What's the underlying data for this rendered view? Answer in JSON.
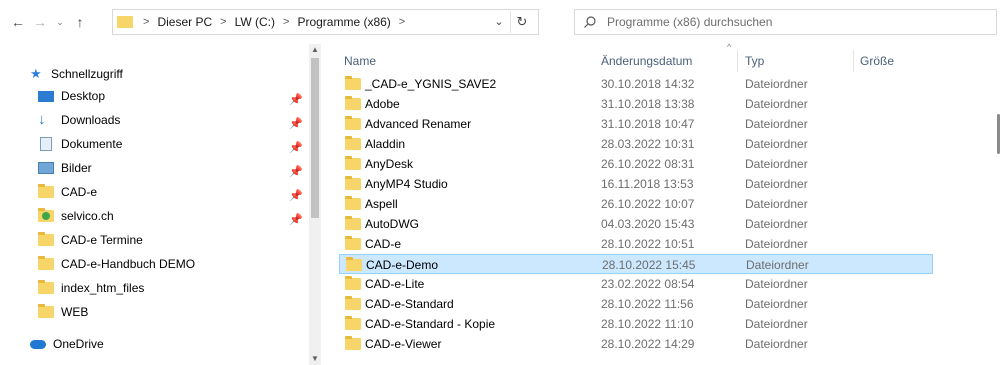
{
  "address": {
    "crumbs": [
      "Dieser PC",
      "LW (C:)",
      "Programme (x86)"
    ],
    "separator": ">"
  },
  "search": {
    "placeholder": "Programme (x86) durchsuchen"
  },
  "nav": {
    "quick_access": "Schnellzugriff",
    "items": [
      {
        "label": "Desktop",
        "icon": "desktop-icon",
        "pinned": true
      },
      {
        "label": "Downloads",
        "icon": "download-icon",
        "pinned": true
      },
      {
        "label": "Dokumente",
        "icon": "documents-icon",
        "pinned": true
      },
      {
        "label": "Bilder",
        "icon": "pictures-icon",
        "pinned": true
      },
      {
        "label": "CAD-e",
        "icon": "folder-icon",
        "pinned": true
      },
      {
        "label": "selvico.ch",
        "icon": "network-folder-icon",
        "pinned": true
      },
      {
        "label": "CAD-e Termine",
        "icon": "folder-icon",
        "pinned": false
      },
      {
        "label": "CAD-e-Handbuch DEMO",
        "icon": "folder-icon",
        "pinned": false
      },
      {
        "label": "index_htm_files",
        "icon": "folder-icon",
        "pinned": false
      },
      {
        "label": "WEB",
        "icon": "folder-icon",
        "pinned": false
      }
    ],
    "onedrive": "OneDrive"
  },
  "columns": {
    "name": "Name",
    "date": "Änderungsdatum",
    "type": "Typ",
    "size": "Größe"
  },
  "files": [
    {
      "name": "_CAD-e_YGNIS_SAVE2",
      "date": "30.10.2018 14:32",
      "type": "Dateiordner"
    },
    {
      "name": "Adobe",
      "date": "31.10.2018 13:38",
      "type": "Dateiordner"
    },
    {
      "name": "Advanced Renamer",
      "date": "31.10.2018 10:47",
      "type": "Dateiordner"
    },
    {
      "name": "Aladdin",
      "date": "28.03.2022 10:31",
      "type": "Dateiordner"
    },
    {
      "name": "AnyDesk",
      "date": "26.10.2022 08:31",
      "type": "Dateiordner"
    },
    {
      "name": "AnyMP4 Studio",
      "date": "16.11.2018 13:53",
      "type": "Dateiordner"
    },
    {
      "name": "Aspell",
      "date": "26.10.2022 10:07",
      "type": "Dateiordner"
    },
    {
      "name": "AutoDWG",
      "date": "04.03.2020 15:43",
      "type": "Dateiordner"
    },
    {
      "name": "CAD-e",
      "date": "28.10.2022 10:51",
      "type": "Dateiordner"
    },
    {
      "name": "CAD-e-Demo",
      "date": "28.10.2022 15:45",
      "type": "Dateiordner",
      "selected": true
    },
    {
      "name": "CAD-e-Lite",
      "date": "23.02.2022 08:54",
      "type": "Dateiordner"
    },
    {
      "name": "CAD-e-Standard",
      "date": "28.10.2022 11:56",
      "type": "Dateiordner"
    },
    {
      "name": "CAD-e-Standard - Kopie",
      "date": "28.10.2022 11:10",
      "type": "Dateiordner"
    },
    {
      "name": "CAD-e-Viewer",
      "date": "28.10.2022 14:29",
      "type": "Dateiordner"
    }
  ],
  "colors": {
    "selection": "#cce8ff",
    "selection_border": "#99d1ff",
    "folder": "#f8d568",
    "header_text": "#4c607a"
  }
}
